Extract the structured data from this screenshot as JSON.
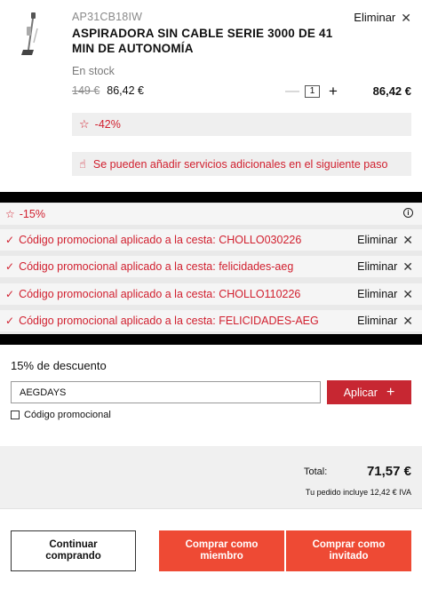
{
  "product": {
    "sku": "AP31CB18IW",
    "name": "ASPIRADORA SIN CABLE SERIE 3000 DE 41 MIN DE AUTONOMÍA",
    "remove_label": "Eliminar",
    "stock": "En stock",
    "old_price": "149 €",
    "new_price": "86,42 €",
    "quantity": "1",
    "line_total": "86,42 €",
    "discount_label": "-42%",
    "services_note": "Se pueden añadir servicios adicionales en el siguiente paso",
    "thumbnail_icon": "vacuum-icon"
  },
  "promotions": {
    "header_discount": "-15%",
    "remove_label": "Eliminar",
    "applied": [
      "Código promocional aplicado a la cesta: CHOLLO030226",
      "Código promocional aplicado a la cesta: felicidades-aeg",
      "Código promocional aplicado a la cesta: CHOLLO110226",
      "Código promocional aplicado a la cesta: FELICIDADES-AEG"
    ]
  },
  "discount_form": {
    "title": "15% de descuento",
    "code_value": "AEGDAYS",
    "apply_label": "Aplicar",
    "checkbox_label": "Código promocional"
  },
  "totals": {
    "label": "Total:",
    "value": "71,57 €",
    "vat_note": "Tu pedido incluye 12,42 € IVA"
  },
  "actions": {
    "continue_label": "Continuar comprando",
    "member_label": "Comprar como miembro",
    "guest_label": "Comprar como invitado"
  },
  "colors": {
    "accent_red": "#d1202f",
    "button_red": "#ee4a34",
    "apply_red": "#c72732"
  }
}
